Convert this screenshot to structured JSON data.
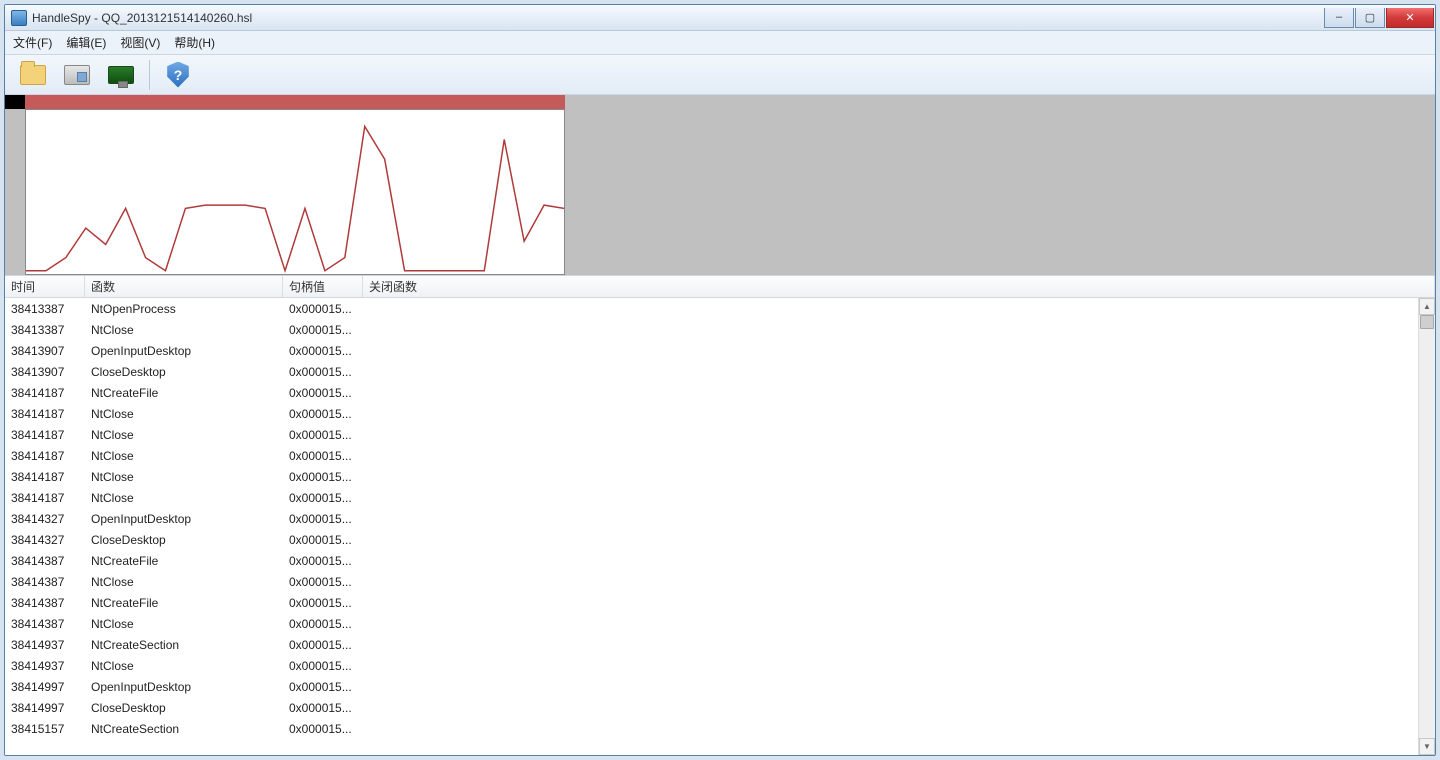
{
  "window": {
    "title": "HandleSpy - QQ_2013121514140260.hsl"
  },
  "menu": {
    "file": "文件(F)",
    "edit": "编辑(E)",
    "view": "视图(V)",
    "help": "帮助(H)"
  },
  "toolbar_icons": {
    "open": "folder-icon",
    "save": "floppy-icon",
    "monitor": "monitor-icon",
    "about": "shield-help-icon"
  },
  "chart_data": {
    "type": "line",
    "title": "",
    "xlabel": "",
    "ylabel": "",
    "ylim": [
      0,
      100
    ],
    "x": [
      0,
      20,
      40,
      60,
      80,
      100,
      120,
      140,
      160,
      180,
      200,
      220,
      240,
      260,
      280,
      300,
      320,
      340,
      360,
      380,
      400,
      420,
      440,
      460,
      480,
      500,
      520,
      540
    ],
    "values": [
      98,
      98,
      90,
      72,
      82,
      60,
      90,
      98,
      60,
      58,
      58,
      58,
      60,
      98,
      60,
      98,
      90,
      10,
      30,
      98,
      98,
      98,
      98,
      98,
      18,
      80,
      58,
      60
    ],
    "note": "y is inverted for drawing; values are approximate pixel heights read from the mini-plot"
  },
  "columns": {
    "time": "时间",
    "func": "函数",
    "handle": "句柄值",
    "close": "关闭函数"
  },
  "rows": [
    {
      "time": "38413387",
      "func": "NtOpenProcess",
      "handle": "0x000015..."
    },
    {
      "time": "38413387",
      "func": "NtClose",
      "handle": "0x000015..."
    },
    {
      "time": "38413907",
      "func": "OpenInputDesktop",
      "handle": "0x000015..."
    },
    {
      "time": "38413907",
      "func": "CloseDesktop",
      "handle": "0x000015..."
    },
    {
      "time": "38414187",
      "func": "NtCreateFile",
      "handle": "0x000015..."
    },
    {
      "time": "38414187",
      "func": "NtClose",
      "handle": "0x000015..."
    },
    {
      "time": "38414187",
      "func": "NtClose",
      "handle": "0x000015..."
    },
    {
      "time": "38414187",
      "func": "NtClose",
      "handle": "0x000015..."
    },
    {
      "time": "38414187",
      "func": "NtClose",
      "handle": "0x000015..."
    },
    {
      "time": "38414187",
      "func": "NtClose",
      "handle": "0x000015..."
    },
    {
      "time": "38414327",
      "func": "OpenInputDesktop",
      "handle": "0x000015..."
    },
    {
      "time": "38414327",
      "func": "CloseDesktop",
      "handle": "0x000015..."
    },
    {
      "time": "38414387",
      "func": "NtCreateFile",
      "handle": "0x000015..."
    },
    {
      "time": "38414387",
      "func": "NtClose",
      "handle": "0x000015..."
    },
    {
      "time": "38414387",
      "func": "NtCreateFile",
      "handle": "0x000015..."
    },
    {
      "time": "38414387",
      "func": "NtClose",
      "handle": "0x000015..."
    },
    {
      "time": "38414937",
      "func": "NtCreateSection",
      "handle": "0x000015..."
    },
    {
      "time": "38414937",
      "func": "NtClose",
      "handle": "0x000015..."
    },
    {
      "time": "38414997",
      "func": "OpenInputDesktop",
      "handle": "0x000015..."
    },
    {
      "time": "38414997",
      "func": "CloseDesktop",
      "handle": "0x000015..."
    },
    {
      "time": "38415157",
      "func": "NtCreateSection",
      "handle": "0x000015..."
    }
  ]
}
